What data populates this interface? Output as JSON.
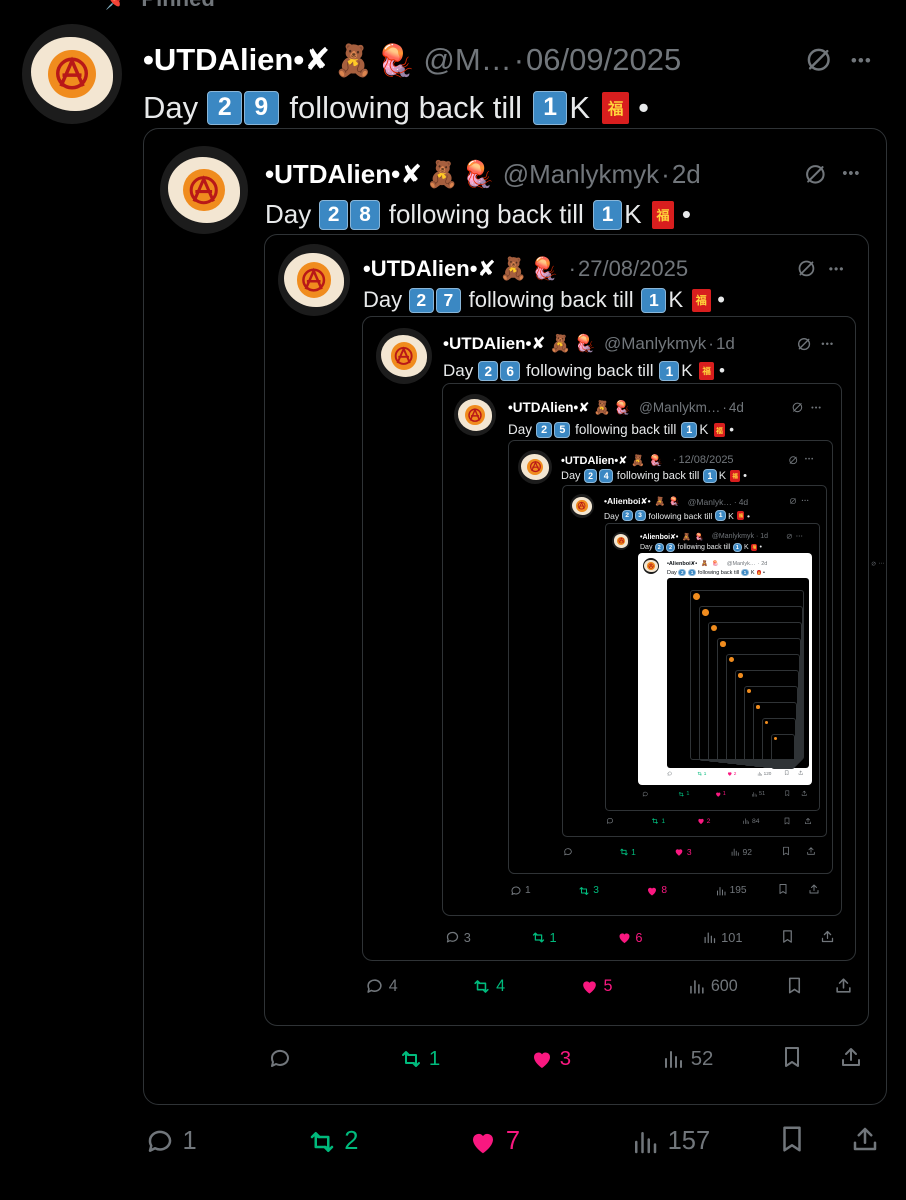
{
  "pinned_label": "Pinned",
  "tweets": [
    {
      "name": "•UTDAlien•✘",
      "handle": "@M…",
      "sep": "·",
      "when": "06/09/2025",
      "day_prefix": "Day",
      "d1": "2",
      "d2": "9",
      "text": "following back till",
      "k1": "1",
      "k": "K",
      "tail": "•",
      "replies": "1",
      "reposts": "2",
      "likes": "7",
      "views": "157"
    },
    {
      "name": "•UTDAlien•✘",
      "handle": "@Manlykmyk",
      "sep": "·",
      "when": "2d",
      "day_prefix": "Day",
      "d1": "2",
      "d2": "8",
      "text": "following back till",
      "k1": "1",
      "k": "K",
      "tail": "•",
      "replies": "",
      "reposts": "1",
      "likes": "3",
      "views": "52"
    },
    {
      "name": "•UTDAlien•✘",
      "handle": "",
      "sep": "·",
      "when": "27/08/2025",
      "day_prefix": "Day",
      "d1": "2",
      "d2": "7",
      "text": "following back till",
      "k1": "1",
      "k": "K",
      "tail": "•",
      "replies": "4",
      "reposts": "4",
      "likes": "5",
      "views": "600"
    },
    {
      "name": "•UTDAlien•✘",
      "handle": "@Manlykmyk",
      "sep": "·",
      "when": "1d",
      "day_prefix": "Day",
      "d1": "2",
      "d2": "6",
      "text": "following back till",
      "k1": "1",
      "k": "K",
      "tail": "•",
      "replies": "3",
      "reposts": "1",
      "likes": "6",
      "views": "101"
    },
    {
      "name": "•UTDAlien•✘",
      "handle": "@Manlykm…",
      "sep": "·",
      "when": "4d",
      "day_prefix": "Day",
      "d1": "2",
      "d2": "5",
      "text": "following back till",
      "k1": "1",
      "k": "K",
      "tail": "•",
      "replies": "1",
      "reposts": "3",
      "likes": "8",
      "views": "195"
    },
    {
      "name": "•UTDAlien•✘",
      "handle": "",
      "sep": "·",
      "when": "12/08/2025",
      "day_prefix": "Day",
      "d1": "2",
      "d2": "4",
      "text": "following back till",
      "k1": "1",
      "k": "K",
      "tail": "•",
      "replies": "",
      "reposts": "1",
      "likes": "3",
      "views": "92"
    },
    {
      "name": "•Alienboi✘•",
      "handle": "@Manlyk…",
      "sep": "·",
      "when": "4d",
      "day_prefix": "Day",
      "d1": "2",
      "d2": "3",
      "text": "following back till",
      "k1": "1",
      "k": "K",
      "tail": "•",
      "replies": "",
      "reposts": "1",
      "likes": "2",
      "views": "84"
    },
    {
      "name": "•Alienboi✘•",
      "handle": "@Manlykmyk",
      "sep": "·",
      "when": "1d",
      "day_prefix": "Day",
      "d1": "2",
      "d2": "2",
      "text": "following back till",
      "k1": "1",
      "k": "K",
      "tail": "•",
      "replies": "",
      "reposts": "1",
      "likes": "1",
      "views": "51"
    },
    {
      "name": "•Alienboi✘•",
      "handle": "@Manlyk…",
      "sep": "·",
      "when": "2d",
      "day_prefix": "Day",
      "d1": "2",
      "d2": "1",
      "text": "following back till",
      "k1": "1",
      "k": "K",
      "tail": "•",
      "replies": "",
      "reposts": "1",
      "likes": "2",
      "views": "120"
    }
  ],
  "icons": {
    "reply": "reply-icon",
    "repost": "repost-icon",
    "like": "heart-icon",
    "views": "views-icon",
    "bookmark": "bookmark-icon",
    "share": "share-icon",
    "grok": "grok-icon",
    "more": "more-icon"
  },
  "colors": {
    "repost": "#00ba7c",
    "like": "#f91880",
    "keycap": "#3b88c3",
    "envelope": "#d81e1e"
  }
}
